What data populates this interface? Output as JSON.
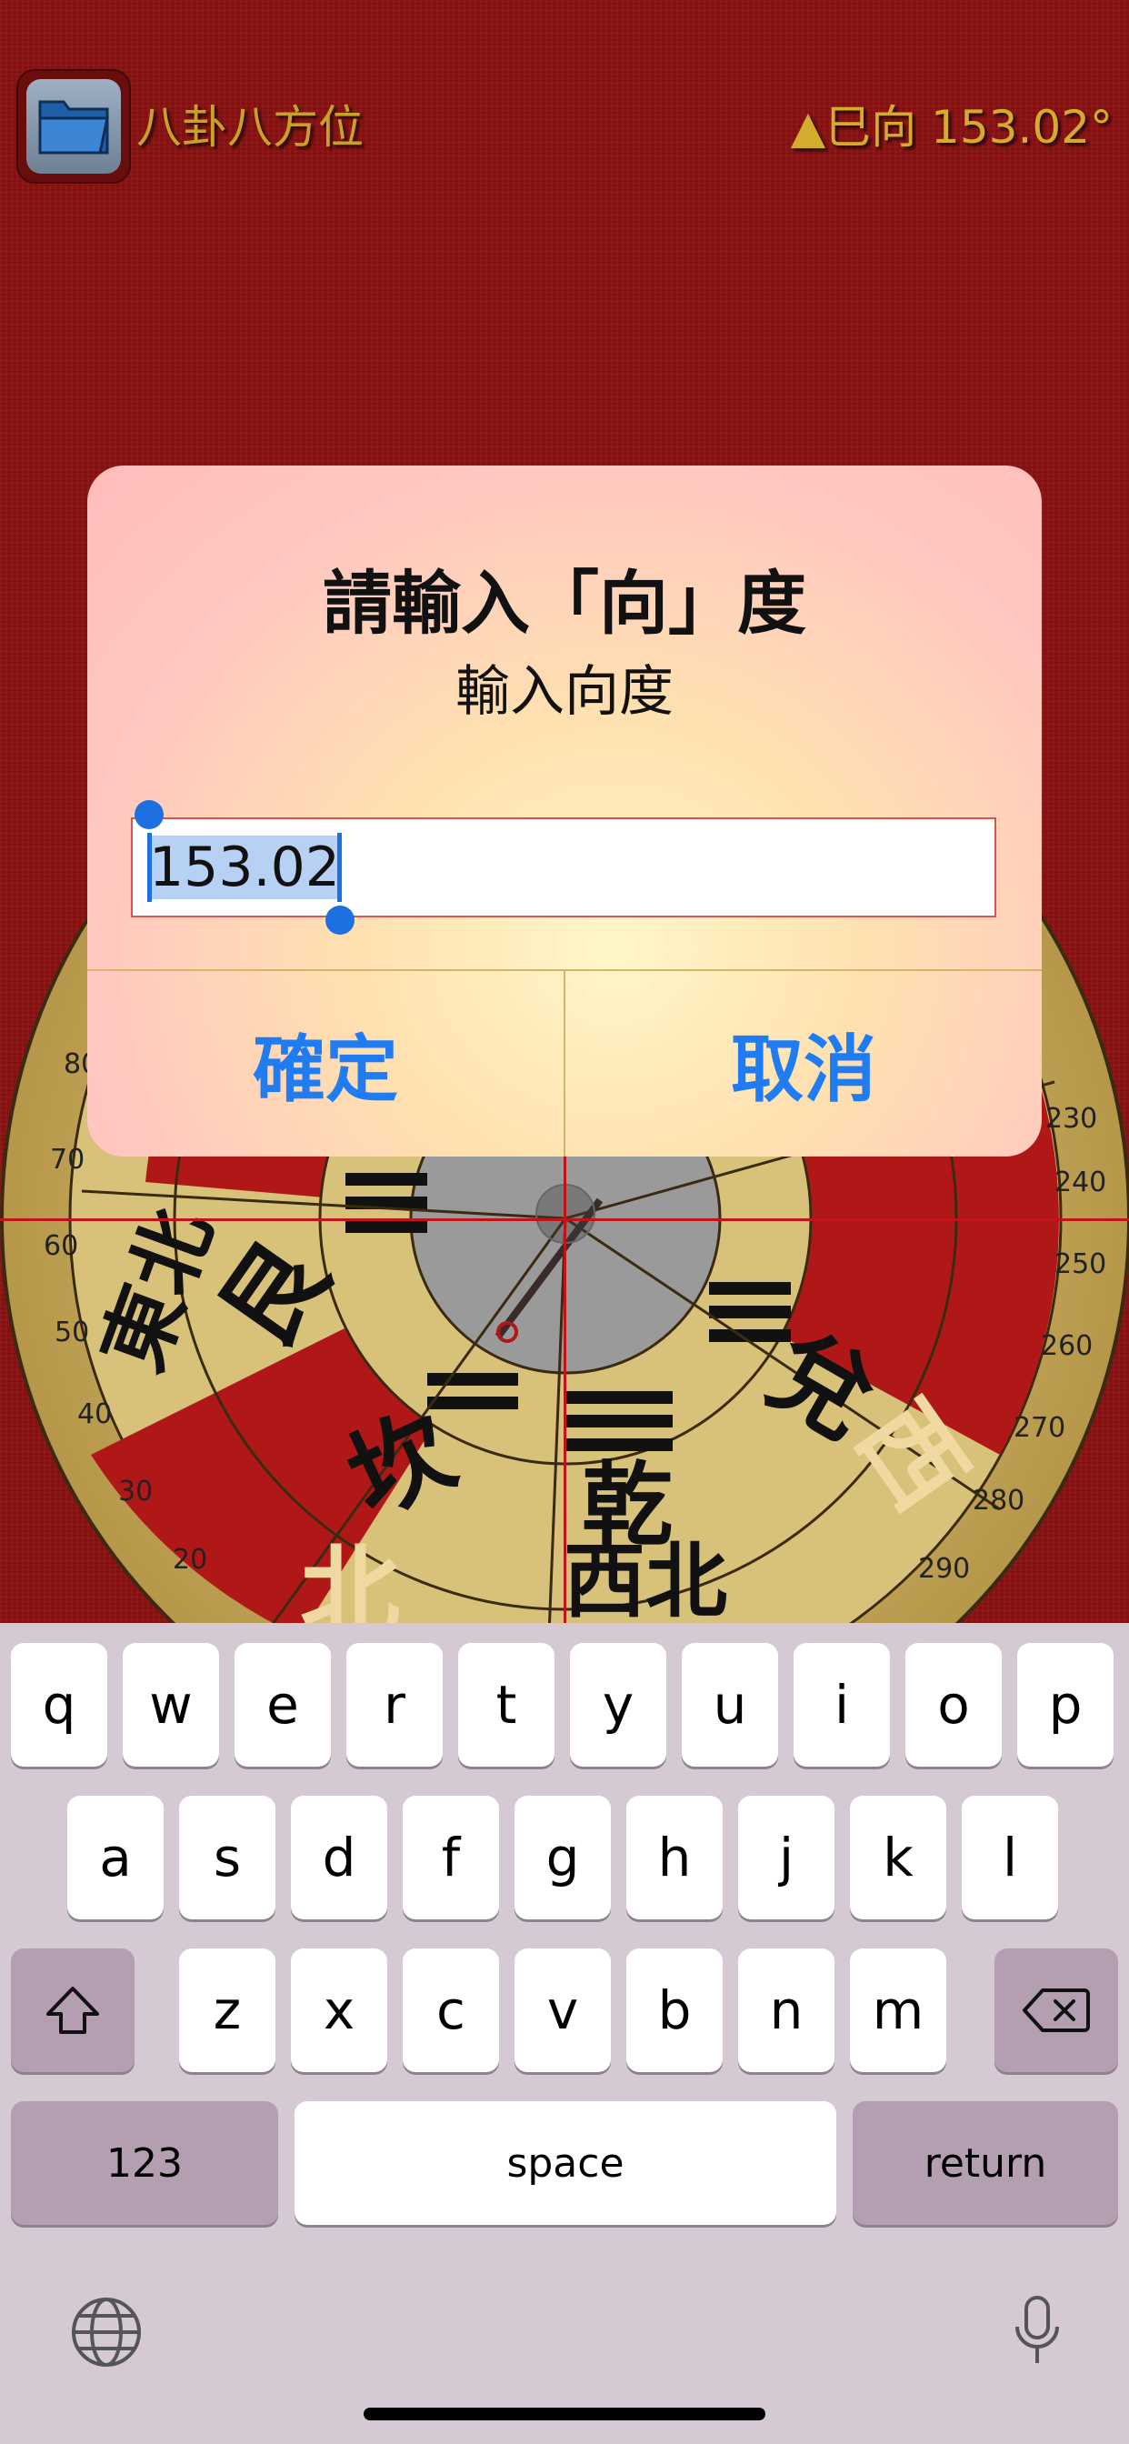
{
  "app": {
    "title": "八卦八方位",
    "heading_readout": "▲巳向 153.02°"
  },
  "compass": {
    "trigram_labels": [
      "東北",
      "艮",
      "坎",
      "乾",
      "兌",
      "西",
      "西北",
      "北"
    ],
    "degree_ticks_left": [
      "80",
      "70",
      "60",
      "50",
      "40",
      "30",
      "20"
    ],
    "degree_ticks_right": [
      "230",
      "240",
      "250",
      "260",
      "270",
      "280",
      "290"
    ]
  },
  "alert": {
    "title": "請輸入「向」度",
    "message": "輸入向度",
    "input_value": "153.02",
    "ok_label": "確定",
    "cancel_label": "取消"
  },
  "keyboard": {
    "row1": [
      "q",
      "w",
      "e",
      "r",
      "t",
      "y",
      "u",
      "i",
      "o",
      "p"
    ],
    "row2": [
      "a",
      "s",
      "d",
      "f",
      "g",
      "h",
      "j",
      "k",
      "l"
    ],
    "row3": [
      "z",
      "x",
      "c",
      "v",
      "b",
      "n",
      "m"
    ],
    "numbers_label": "123",
    "space_label": "space",
    "return_label": "return"
  },
  "colors": {
    "background_red": "#8a1212",
    "gold": "#c8a227",
    "ios_blue": "#1f7cf2"
  }
}
